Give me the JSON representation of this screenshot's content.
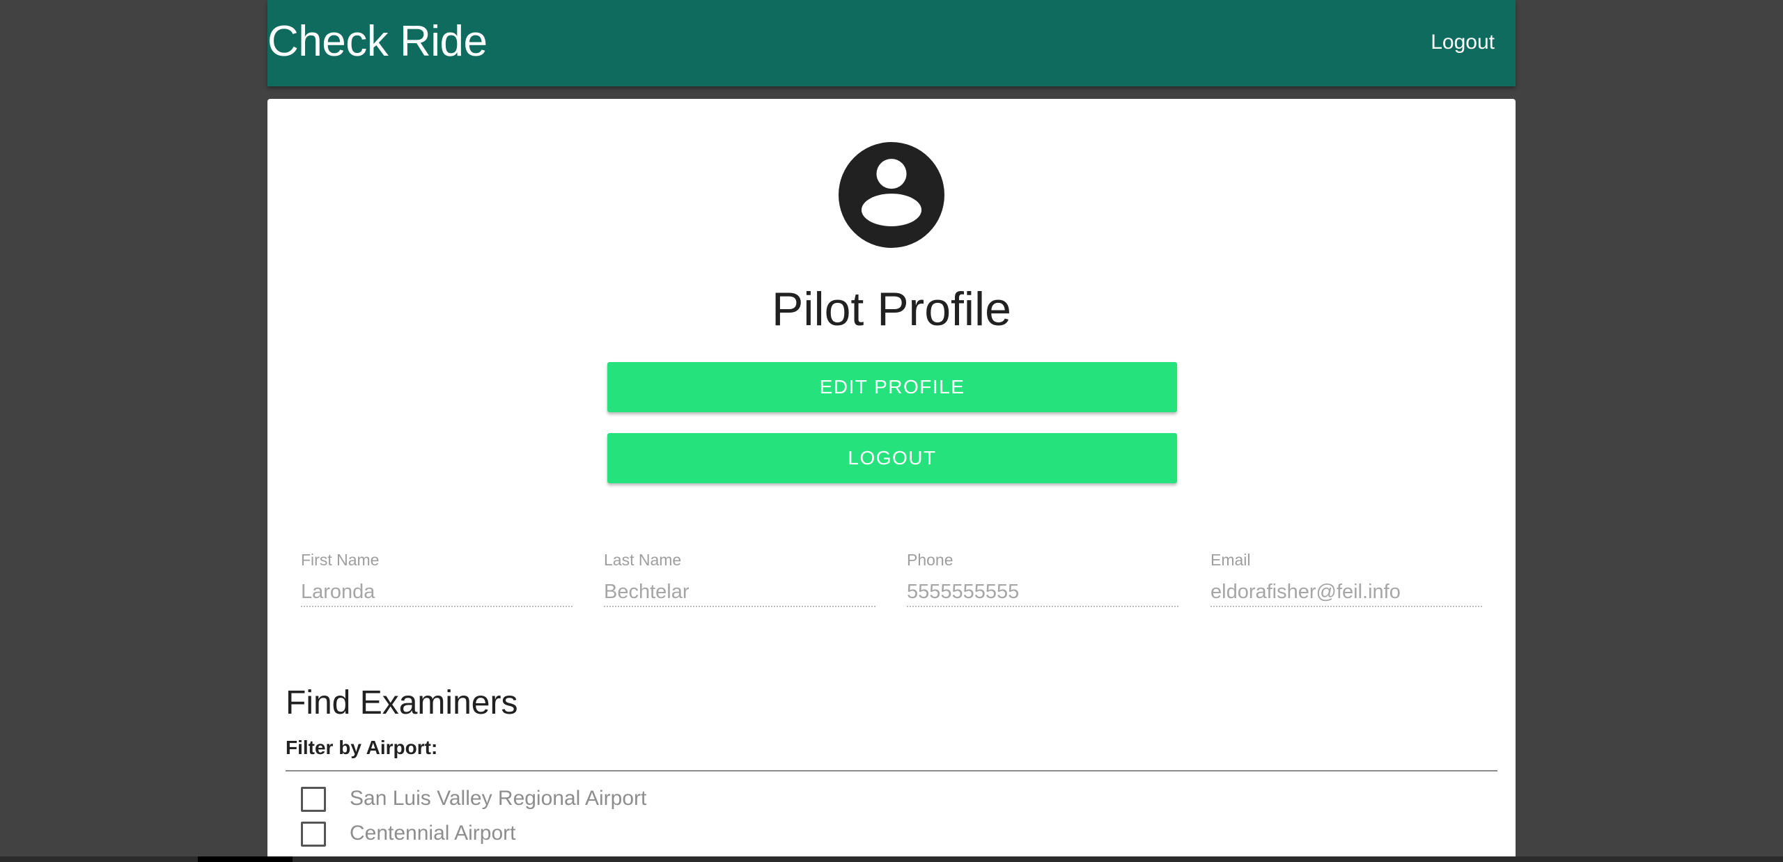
{
  "appbar": {
    "title": "Check Ride",
    "logout_label": "Logout"
  },
  "profile": {
    "avatar_icon": "account-circle-icon",
    "title": "Pilot Profile",
    "edit_button": "EDIT PROFILE",
    "logout_button": "LOGOUT",
    "fields": [
      {
        "label": "First Name",
        "value": "Laronda"
      },
      {
        "label": "Last Name",
        "value": "Bechtelar"
      },
      {
        "label": "Phone",
        "value": "5555555555"
      },
      {
        "label": "Email",
        "value": "eldorafisher@feil.info"
      }
    ]
  },
  "examiners": {
    "title": "Find Examiners",
    "filter_label": "Filter by Airport:",
    "airports": [
      {
        "name": "San Luis Valley Regional Airport",
        "checked": false
      },
      {
        "name": "Centennial Airport",
        "checked": false
      }
    ]
  },
  "colors": {
    "appbar": "#0f6b5e",
    "button": "#26e27d",
    "background": "#424242"
  }
}
